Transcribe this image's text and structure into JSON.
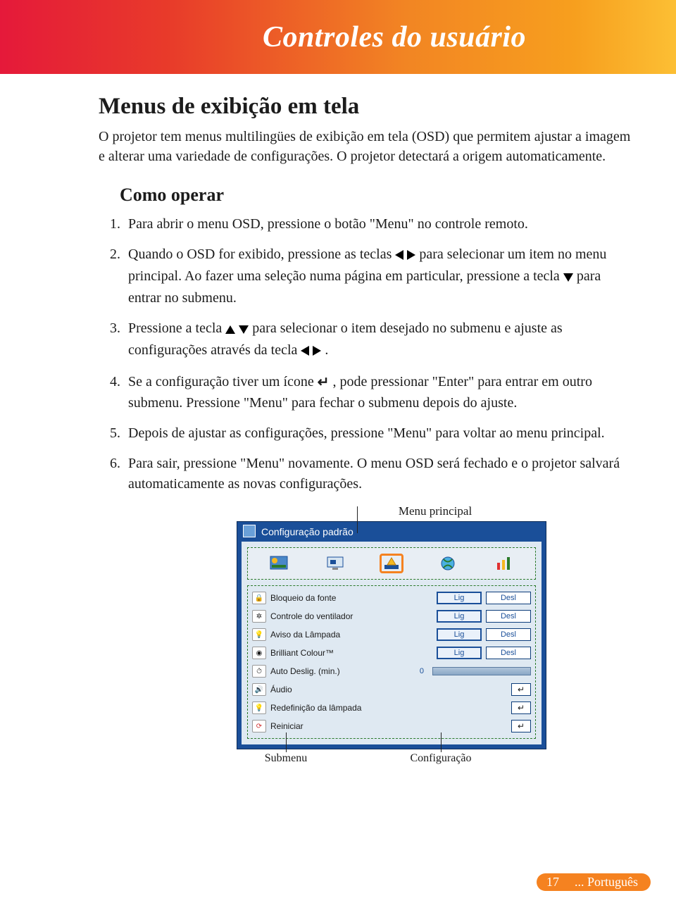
{
  "header_title": "Controles do usuário",
  "h2": "Menus de exibição em tela",
  "intro": "O projetor tem menus multilingües de exibição em tela (OSD) que permitem ajustar a imagem e alterar uma variedade de configurações. O projetor detectará a origem automaticamente.",
  "subhead": "Como operar",
  "steps": {
    "s1": "Para abrir o menu OSD, pressione o botão \"Menu\" no controle remoto.",
    "s2a": "Quando o OSD for exibido, pressione as teclas ",
    "s2b": " para selecionar um item no menu principal. Ao fazer uma seleção numa página em particular, pressione a tecla ",
    "s2c": " para entrar no submenu.",
    "s3a": "Pressione a tecla ",
    "s3b": " para selecionar o item desejado no submenu e ajuste as configurações através da tecla ",
    "s3c": ".",
    "s4a": "Se a configuração tiver um ícone ",
    "s4b": " , pode pressionar \"Enter\" para entrar em outro submenu. Pressione \"Menu\" para fechar o submenu depois do ajuste.",
    "s5": "Depois de ajustar as configurações, pressione \"Menu\" para voltar ao menu principal.",
    "s6": "Para sair, pressione \"Menu\" novamente. O menu OSD será fechado e o projetor salvará automaticamente as novas configurações."
  },
  "osd": {
    "caption_main": "Menu principal",
    "title": "Configuração padrão",
    "rows": [
      {
        "label": "Bloqueio da fonte",
        "type": "toggle",
        "on": "Lig",
        "off": "Desl",
        "sel": "on"
      },
      {
        "label": "Controle do ventilador",
        "type": "toggle",
        "on": "Lig",
        "off": "Desl",
        "sel": "on"
      },
      {
        "label": "Aviso da Lâmpada",
        "type": "toggle",
        "on": "Lig",
        "off": "Desl",
        "sel": "on"
      },
      {
        "label": "Brilliant Colour™",
        "type": "toggle",
        "on": "Lig",
        "off": "Desl",
        "sel": "on"
      },
      {
        "label": "Auto Deslig. (min.)",
        "type": "slider",
        "value": "0"
      },
      {
        "label": "Áudio",
        "type": "enter"
      },
      {
        "label": "Redefinição da lâmpada",
        "type": "enter"
      },
      {
        "label": "Reiniciar",
        "type": "enter"
      }
    ],
    "label_submenu": "Submenu",
    "label_config": "Configuração"
  },
  "footer": {
    "page": "17",
    "lang": "... Português"
  }
}
